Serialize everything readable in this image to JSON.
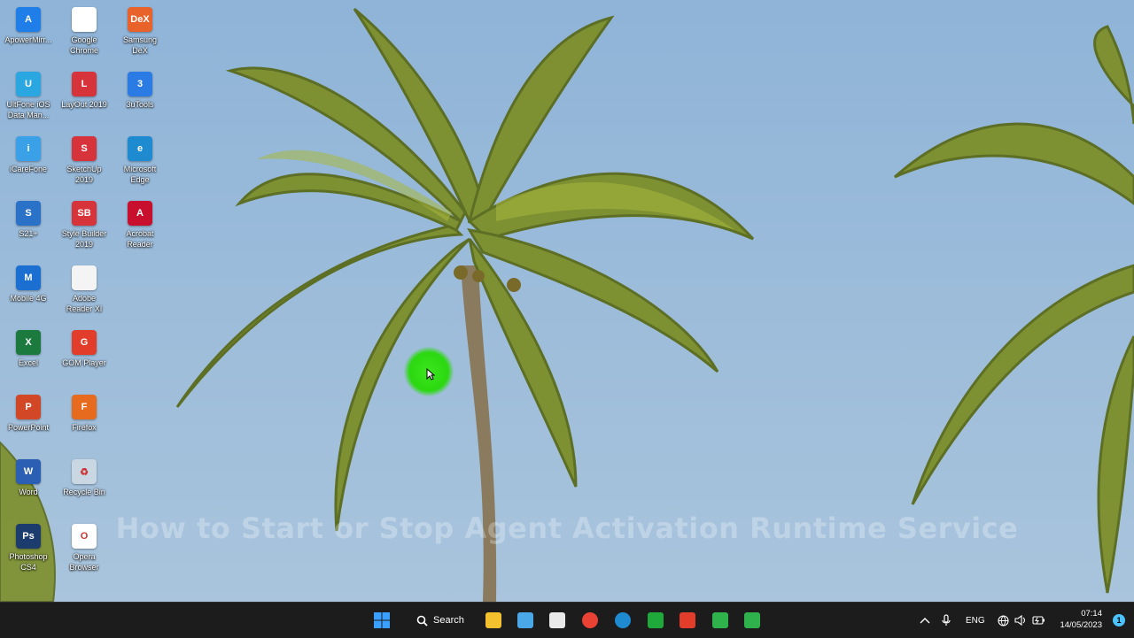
{
  "desktop": {
    "icons": [
      {
        "label": "ApowerMirr...",
        "color": "#1f7ee8",
        "glyph": "A",
        "icon": "apowermirror-icon"
      },
      {
        "label": "Google\nChrome",
        "color": "#ffffff",
        "glyph": "",
        "icon": "chrome-icon"
      },
      {
        "label": "Samsung\nDeX",
        "color": "#e8622a",
        "glyph": "DeX",
        "icon": "samsung-dex-icon"
      },
      {
        "label": "UltFone iOS\nData Man...",
        "color": "#2aa7e0",
        "glyph": "U",
        "icon": "ultfone-icon"
      },
      {
        "label": "LayOut 2019",
        "color": "#d6333b",
        "glyph": "L",
        "icon": "layout-icon"
      },
      {
        "label": "3uTools",
        "color": "#2a7be4",
        "glyph": "3",
        "icon": "3utools-icon"
      },
      {
        "label": "iCareFone",
        "color": "#3aa0e8",
        "glyph": "i",
        "icon": "icarefone-icon"
      },
      {
        "label": "SketchUp\n2019",
        "color": "#d6333b",
        "glyph": "S",
        "icon": "sketchup-icon"
      },
      {
        "label": "Microsoft\nEdge",
        "color": "#1e8bd1",
        "glyph": "e",
        "icon": "edge-icon"
      },
      {
        "label": "S21+",
        "color": "#2a72c8",
        "glyph": "S",
        "icon": "s21-icon"
      },
      {
        "label": "Style Builder\n2019",
        "color": "#d6333b",
        "glyph": "SB",
        "icon": "style-builder-icon"
      },
      {
        "label": "Acrobat\nReader",
        "color": "#c8102e",
        "glyph": "A",
        "icon": "acrobat-icon"
      },
      {
        "label": "Mobile 4G",
        "color": "#1b6fd0",
        "glyph": "M",
        "icon": "mobile-4g-icon"
      },
      {
        "label": "Adobe\nReader XI",
        "color": "#f4f4f4",
        "glyph": "",
        "icon": "document-icon"
      },
      {
        "label": "Excel",
        "color": "#1d7a3e",
        "glyph": "X",
        "icon": "excel-icon"
      },
      {
        "label": "GOM Player",
        "color": "#e23c2a",
        "glyph": "G",
        "icon": "gom-player-icon"
      },
      {
        "label": "PowerPoint",
        "color": "#d24726",
        "glyph": "P",
        "icon": "powerpoint-icon"
      },
      {
        "label": "Firefox",
        "color": "#e76b1f",
        "glyph": "F",
        "icon": "firefox-icon"
      },
      {
        "label": "Word",
        "color": "#2b5fb4",
        "glyph": "W",
        "icon": "word-icon"
      },
      {
        "label": "Recycle Bin",
        "color": "#c9d7e3",
        "glyph": "♻",
        "icon": "recycle-bin-icon"
      },
      {
        "label": "Photoshop\nCS4",
        "color": "#1c3c6e",
        "glyph": "Ps",
        "icon": "photoshop-icon"
      },
      {
        "label": "Opera\nBrowser",
        "color": "#ffffff",
        "glyph": "O",
        "icon": "opera-icon"
      }
    ]
  },
  "overlay_title": "How to Start or Stop Agent Activation Runtime Service",
  "taskbar": {
    "search_label": "Search",
    "apps": [
      {
        "name": "start-button",
        "color": "#3aa0ff"
      },
      {
        "name": "file-explorer-icon",
        "color": "#f3c12e"
      },
      {
        "name": "notepad-icon",
        "color": "#4aa8e8"
      },
      {
        "name": "store-icon",
        "color": "#e9e9e9"
      },
      {
        "name": "chrome-taskbar-icon",
        "color": "#e94235"
      },
      {
        "name": "edge-taskbar-icon",
        "color": "#1e8bd1"
      },
      {
        "name": "app-heart-icon",
        "color": "#1fa93b"
      },
      {
        "name": "recorder-icon",
        "color": "#e23c2a"
      },
      {
        "name": "camtasia-icon",
        "color": "#2fb24c"
      },
      {
        "name": "camtasia-2-icon",
        "color": "#2fb24c"
      }
    ],
    "tray": {
      "language": "ENG",
      "time": "07:14",
      "date": "14/05/2023",
      "notifications": "1"
    }
  }
}
